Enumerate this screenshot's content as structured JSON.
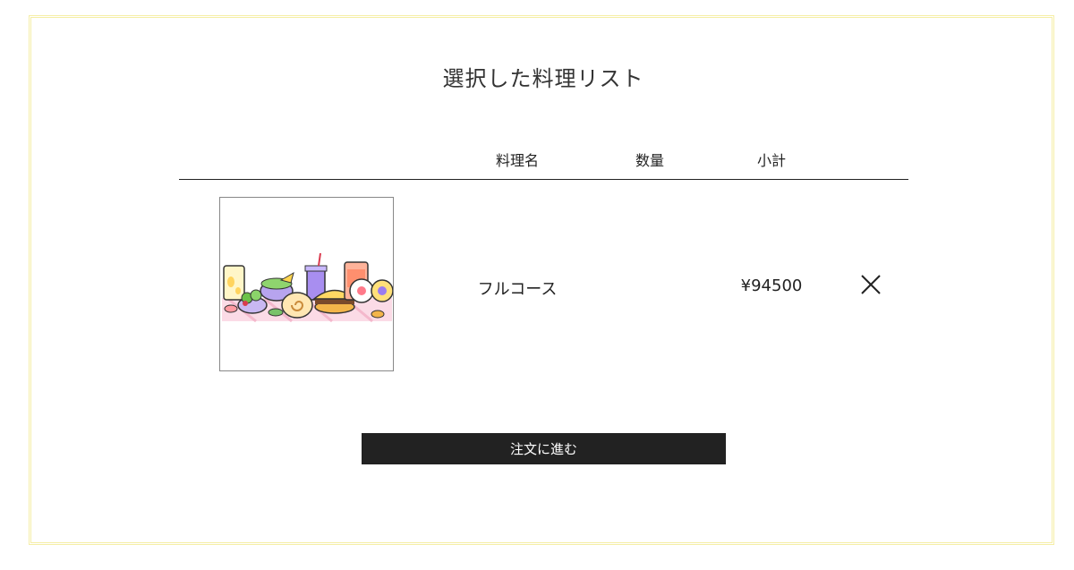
{
  "page": {
    "title": "選択した料理リスト"
  },
  "table": {
    "headers": {
      "name": "料理名",
      "quantity": "数量",
      "subtotal": "小計"
    },
    "rows": [
      {
        "image_icon": "food-spread-illustration",
        "name": "フルコース",
        "quantity": "",
        "subtotal": "¥94500",
        "remove_icon": "close-icon"
      }
    ]
  },
  "actions": {
    "order_label": "注文に進む"
  },
  "colors": {
    "frame_border": "#f5eea6",
    "button_bg": "#222222",
    "button_text": "#ffffff"
  }
}
